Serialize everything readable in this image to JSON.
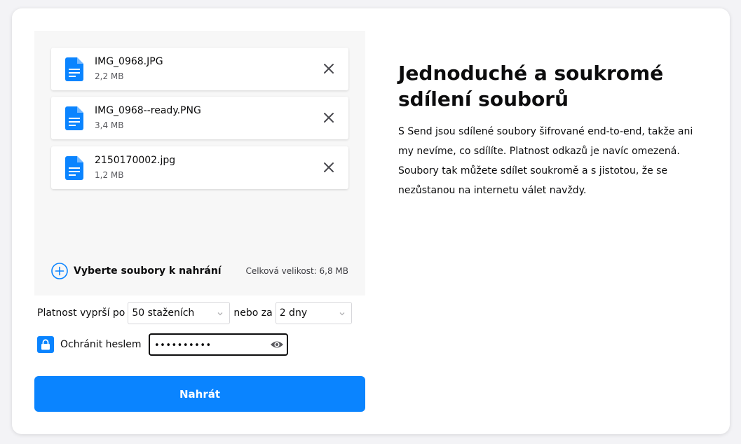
{
  "upload": {
    "files": [
      {
        "name": "IMG_0968.JPG",
        "size": "2,2 MB"
      },
      {
        "name": "IMG_0968--ready.PNG",
        "size": "3,4 MB"
      },
      {
        "name": "2150170002.jpg",
        "size": "1,2 MB"
      }
    ],
    "add_files_label": "Vyberte soubory k nahrání",
    "total_size": "Celková velikost: 6,8 MB"
  },
  "expiry": {
    "prefix": "Platnost vyprší po",
    "downloads_selected": "50 staženích",
    "middle": "nebo za",
    "time_selected": "2 dny"
  },
  "password": {
    "label": "Ochránit heslem",
    "value": "••••••••••",
    "checked": true
  },
  "upload_button_label": "Nahrát",
  "info": {
    "heading": "Jednoduché a soukromé sdílení souborů",
    "description": "S Send jsou sdílené soubory šifrované end-to-end, takže ani my nevíme, co sdílíte. Platnost odkazů je navíc omezená. Soubory tak můžete sdílet soukromě a s jistotou, že se nezůstanou na internetu válet navždy."
  },
  "colors": {
    "accent": "#0a84ff",
    "page_background": "#f3f3f6",
    "card_background": "#ffffff",
    "upload_area_background": "#f7f7f7"
  }
}
